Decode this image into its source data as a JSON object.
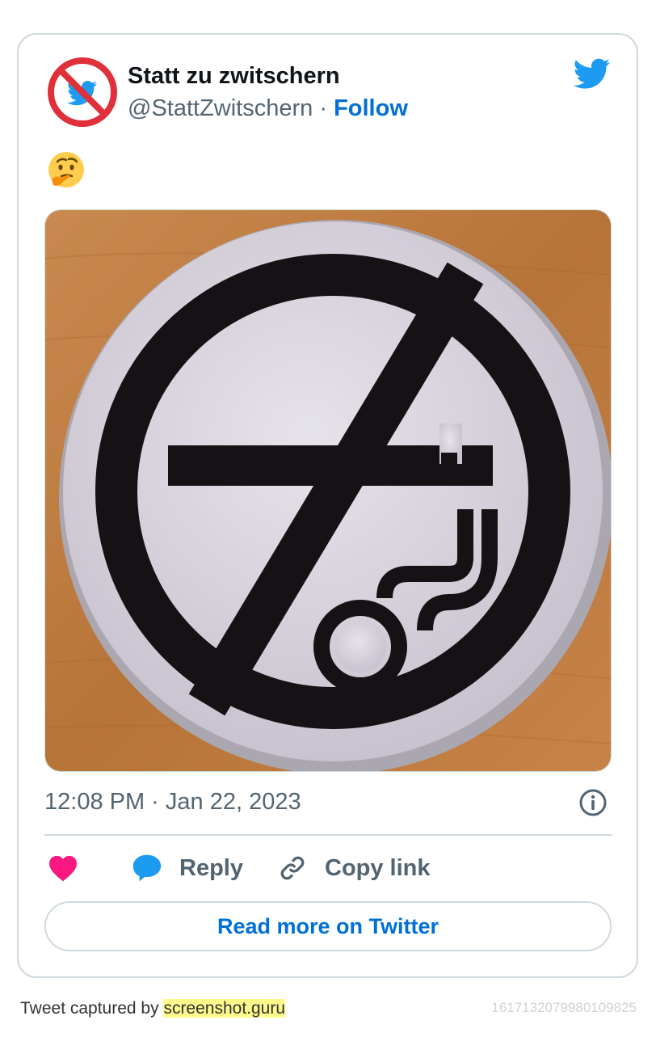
{
  "author": {
    "name": "Statt zu zwitschern",
    "handle": "@StattZwitschern",
    "separator": " · ",
    "follow_label": "Follow"
  },
  "tweet": {
    "text_emoji": "thinking-face-icon",
    "timestamp": "12:08 PM · Jan 22, 2023"
  },
  "actions": {
    "reply_label": "Reply",
    "copy_label": "Copy link"
  },
  "read_more_label": "Read more on Twitter",
  "footer": {
    "prefix": "Tweet captured by ",
    "link": "screenshot.guru",
    "tweet_id": "1617132079980109825"
  },
  "colors": {
    "twitter_blue": "#1d9bf0",
    "link_blue": "#006fd6",
    "like_pink": "#f91880",
    "muted": "#536471",
    "border": "#cfd9de"
  }
}
